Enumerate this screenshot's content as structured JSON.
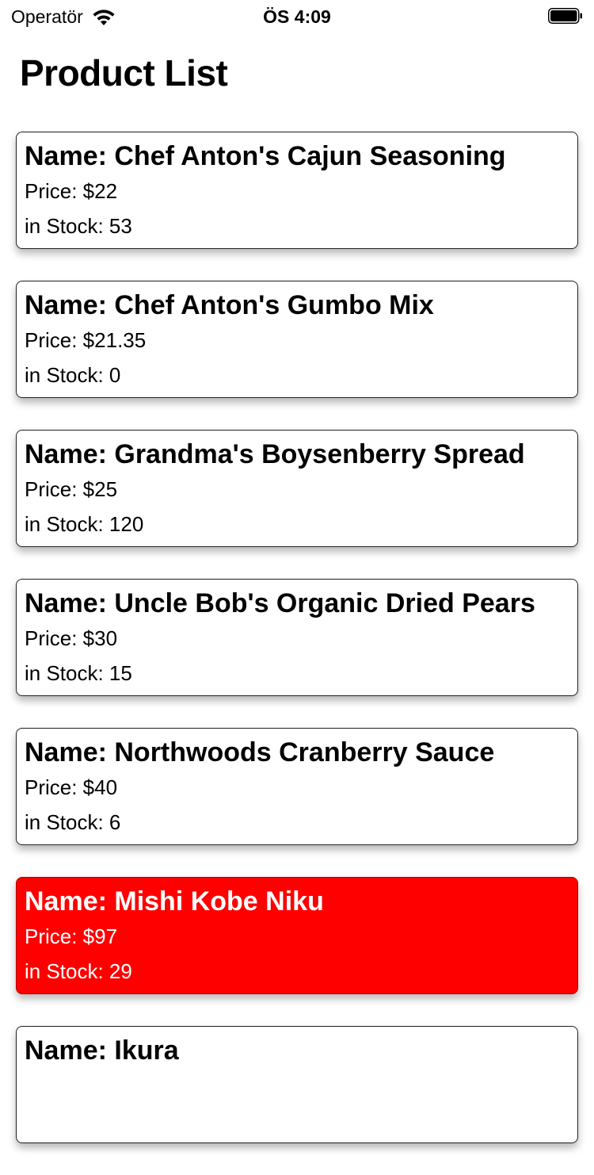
{
  "status_bar": {
    "carrier": "Operatör",
    "time": "ÖS 4:09"
  },
  "page": {
    "title": "Product List"
  },
  "products": [
    {
      "name": "Name: Chef Anton's Cajun Seasoning",
      "price": "Price: $22",
      "stock": "in Stock: 53",
      "highlighted": false
    },
    {
      "name": "Name: Chef Anton's Gumbo Mix",
      "price": "Price: $21.35",
      "stock": "in Stock: 0",
      "highlighted": false
    },
    {
      "name": "Name: Grandma's Boysenberry Spread",
      "price": "Price: $25",
      "stock": "in Stock: 120",
      "highlighted": false
    },
    {
      "name": "Name: Uncle Bob's Organic Dried Pears",
      "price": "Price: $30",
      "stock": "in Stock: 15",
      "highlighted": false
    },
    {
      "name": "Name: Northwoods Cranberry Sauce",
      "price": "Price: $40",
      "stock": "in Stock: 6",
      "highlighted": false
    },
    {
      "name": "Name: Mishi Kobe Niku",
      "price": "Price: $97",
      "stock": "in Stock: 29",
      "highlighted": true
    },
    {
      "name": "Name: Ikura",
      "price": "",
      "stock": "",
      "highlighted": false
    }
  ],
  "colors": {
    "highlight": "#ff0000",
    "card_border": "#222222"
  }
}
